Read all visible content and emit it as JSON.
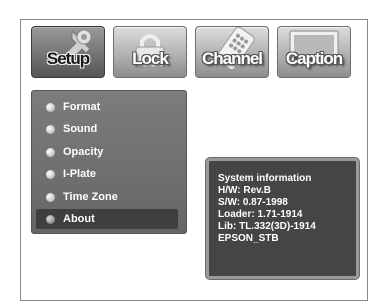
{
  "tabs": [
    {
      "label": "Setup",
      "icon": "wrench-icon",
      "active": true
    },
    {
      "label": "Lock",
      "icon": "padlock-icon",
      "active": false
    },
    {
      "label": "Channel",
      "icon": "remote-control-icon",
      "active": false
    },
    {
      "label": "Caption",
      "icon": "caption-screen-icon",
      "active": false
    }
  ],
  "menu": {
    "items": [
      {
        "label": "Format"
      },
      {
        "label": "Sound"
      },
      {
        "label": "Opacity"
      },
      {
        "label": "I-Plate"
      },
      {
        "label": "Time Zone"
      },
      {
        "label": "About",
        "selected": true
      }
    ]
  },
  "info": {
    "title": "System information",
    "lines": [
      "H/W: Rev.B",
      "S/W: 0.87-1998",
      "Loader: 1.71-1914",
      "Lib: TL.332(3D)-1914",
      "EPSON_STB"
    ]
  }
}
